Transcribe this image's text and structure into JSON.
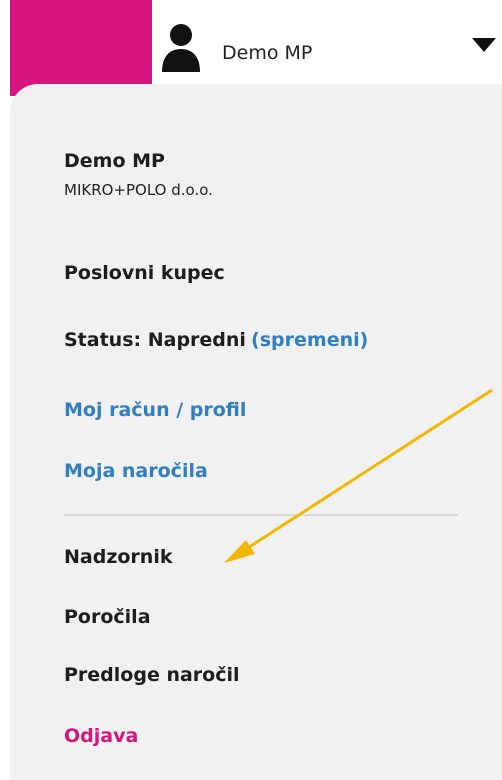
{
  "header": {
    "user_name": "Demo MP",
    "user_icon": "user-icon",
    "dropdown_icon": "caret-down-icon"
  },
  "menu": {
    "name": "Demo MP",
    "company": "MIKRO+POLO d.o.o.",
    "customer_type": "Poslovni kupec",
    "status_label": "Status: Napredni",
    "status_change": "(spremeni)",
    "account_link": "Moj račun / profil",
    "orders_link": "Moja naročila",
    "supervisor": "Nadzornik",
    "reports": "Poročila",
    "order_templates": "Predloge naročil",
    "logout": "Odjava"
  },
  "colors": {
    "accent_pink": "#d6157f",
    "link_blue": "#2f7fc1",
    "arrow_yellow": "#f2b705",
    "panel_bg": "#f1f1f1"
  }
}
